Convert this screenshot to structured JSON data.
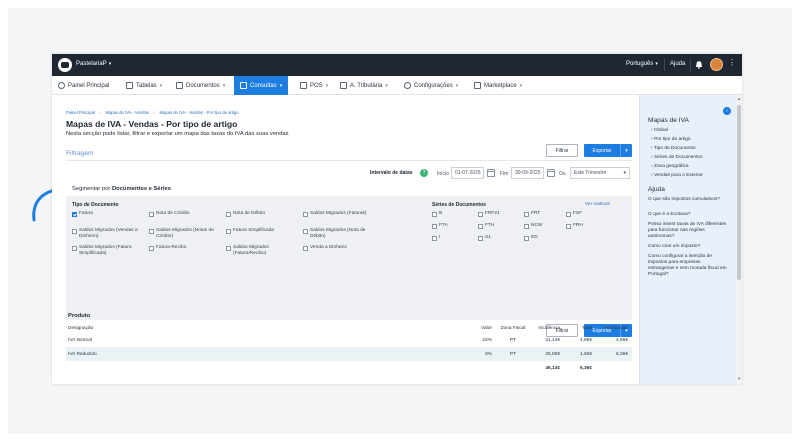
{
  "topbar": {
    "company": "PastelariaP",
    "language": "Português",
    "help": "Ajuda"
  },
  "nav": [
    {
      "label": "Painel Principal",
      "icon": "gauge-icon"
    },
    {
      "label": "Tabelas",
      "icon": "table-icon"
    },
    {
      "label": "Documentos",
      "icon": "document-icon"
    },
    {
      "label": "Consultas",
      "icon": "chart-icon",
      "active": true
    },
    {
      "label": "POS",
      "icon": "pos-icon"
    },
    {
      "label": "A. Tributária",
      "icon": "bank-icon"
    },
    {
      "label": "Configurações",
      "icon": "settings-icon"
    },
    {
      "label": "Marketplace",
      "icon": "marketplace-icon"
    }
  ],
  "breadcrumb": [
    "Painel Principal",
    "Mapas de IVA - Vendas",
    "Mapas de IVA - Vendas - Por tipo de artigo"
  ],
  "page": {
    "title": "Mapas de IVA - Vendas - Por tipo de artigo",
    "subtitle": "Nesta secção pode listar, filtrar e exportar um mapa das taxas do IVA das suas vendas",
    "filter_button": "Filtrar",
    "export_button": "Exportar",
    "filtragem": "Filtragem"
  },
  "dates": {
    "label": "Intervalo de datas",
    "start_label": "Início",
    "start_value": "01-07-2025",
    "end_label": "Fim",
    "end_value": "30-09-2025",
    "or_label": "Ou",
    "period_value": "Este Trimestre"
  },
  "segment": {
    "prefix": "Segmentar por ",
    "bold": "Documentos e Séries"
  },
  "doc_types": {
    "title": "Tipo de Documento",
    "items": [
      {
        "label": "Fatura",
        "checked": true
      },
      {
        "label": "Nota de Crédito",
        "checked": false
      },
      {
        "label": "Nota de Débito",
        "checked": false
      },
      {
        "label": "Saldos Migrados (Faturas)",
        "checked": false
      },
      {
        "label": "Saldos Migrados (Vendas a Dinheiro)",
        "checked": false
      },
      {
        "label": "Saldos Migrados (Notas de Crédito)",
        "checked": false
      },
      {
        "label": "Fatura Simplificada",
        "checked": false
      },
      {
        "label": "Saldos Migrados (Nota de Débito)",
        "checked": false
      },
      {
        "label": "Saldos Migrados (Fatura Simplificada)",
        "checked": false
      },
      {
        "label": "Fatura-Recibo",
        "checked": false
      },
      {
        "label": "Saldos Migrados (Fatura/Recibo)",
        "checked": false
      },
      {
        "label": "Venda a Dinheiro",
        "checked": false
      }
    ]
  },
  "series": {
    "title": "Séries de Documentos",
    "show_inactive": "Ver inativos",
    "items": [
      "B",
      "FRF21",
      "FRT",
      "FSF",
      "FTA",
      "FTH",
      "NCW",
      "FRH",
      "I",
      "S1",
      "ED"
    ]
  },
  "produto": {
    "title": "Produto",
    "headers": [
      "Designação",
      "Valor",
      "Zona Fiscal",
      "Incidência",
      "Total",
      "Acumulado"
    ],
    "rows": [
      [
        "IVA Normal",
        "23%",
        "PT",
        "21,14€",
        "4,86€",
        "4,86€"
      ],
      [
        "IVA Reduzido",
        "6%",
        "PT",
        "25,00€",
        "1,50€",
        "6,36€"
      ]
    ],
    "totals": {
      "incidencia": "46,14€",
      "total": "6,36€"
    }
  },
  "right_panel": {
    "title": "Mapas de IVA",
    "links": [
      "Global",
      "Por tipo de artigo",
      "Tipo de Documento",
      "Séries de Documentos",
      "Zona geográfica",
      "Vendas para o Exterior"
    ],
    "help_title": "Ajuda",
    "help_links": [
      "O que são impostos cumulativos?",
      "O que é a Ecotaxa?",
      "Posso inserir taxas de IVA diferentes para funcionar nas regiões autónomas?",
      "Como criar um imposto?",
      "Como configurar a isenção de impostos para empresas estrangeiras e sem morada fiscal em Portugal?"
    ]
  },
  "colors": {
    "accent": "#1e7de0",
    "topbar": "#1f2732",
    "panel": "#e8f1fa"
  }
}
